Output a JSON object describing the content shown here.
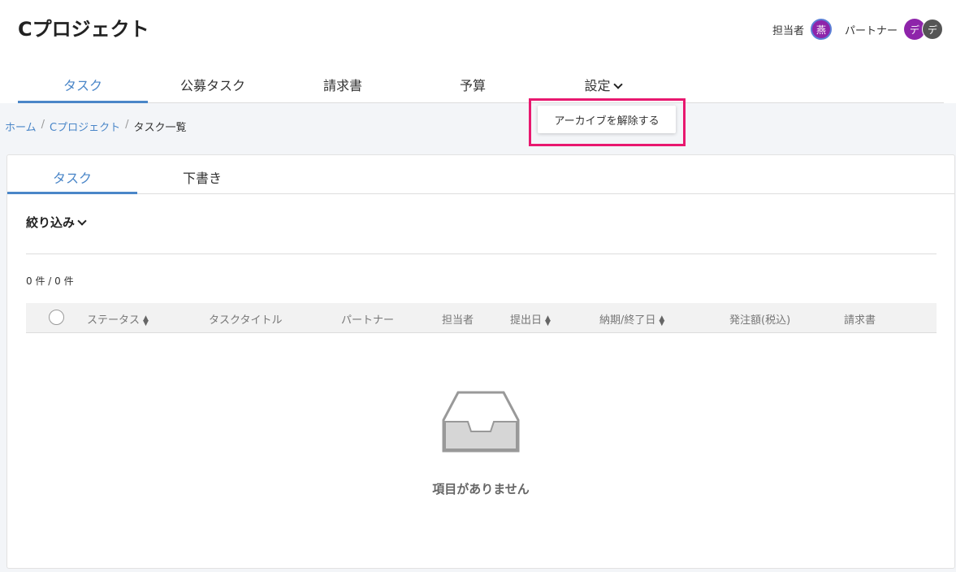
{
  "project": {
    "title": "Cプロジェクト"
  },
  "header": {
    "owner_label": "担当者",
    "owner_avatar": "燕",
    "partner_label": "パートナー",
    "partner_avatars": [
      "デ",
      "デ"
    ]
  },
  "main_tabs": [
    {
      "label": "タスク",
      "active": true
    },
    {
      "label": "公募タスク"
    },
    {
      "label": "請求書"
    },
    {
      "label": "予算"
    },
    {
      "label": "設定"
    }
  ],
  "dropdown": {
    "item": "アーカイブを解除する"
  },
  "breadcrumb": {
    "home": "ホーム",
    "project": "Cプロジェクト",
    "current": "タスク一覧",
    "separator": "/"
  },
  "sub_tabs": [
    {
      "label": "タスク",
      "active": true
    },
    {
      "label": "下書き"
    }
  ],
  "filter": {
    "label": "絞り込み"
  },
  "count": {
    "text": "0 件 / 0 件"
  },
  "table": {
    "columns": [
      "ステータス",
      "タスクタイトル",
      "パートナー",
      "担当者",
      "提出日",
      "納期/終了日",
      "発注額(税込)",
      "請求書"
    ]
  },
  "empty": {
    "message": "項目がありません",
    "icon": "inbox-tray-icon"
  },
  "colors": {
    "accent": "#4a86c8",
    "highlight": "#e8186f",
    "avatar_purple": "#8e24aa"
  }
}
